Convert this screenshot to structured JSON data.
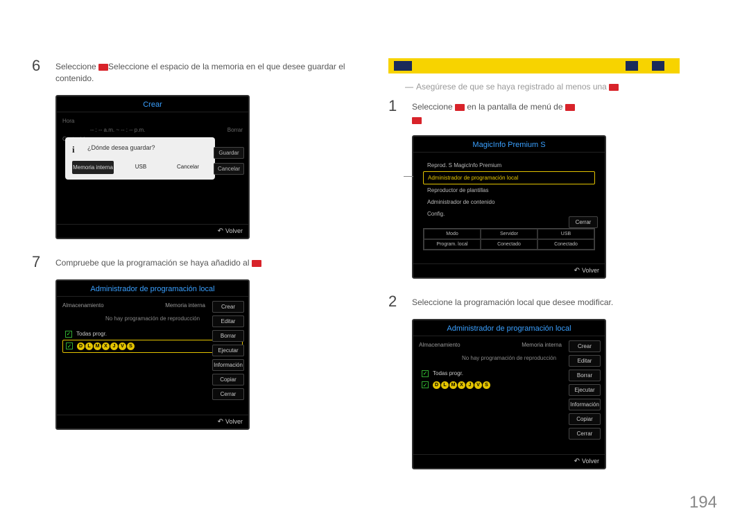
{
  "page_number": "194",
  "left": {
    "step6": {
      "num": "6",
      "text_a": "Seleccione ",
      "text_b": "Seleccione el espacio de la memoria en el que desee guardar el contenido."
    },
    "crear": {
      "title": "Crear",
      "hora": "Hora",
      "time": "-- : -- a.m. ~ -- : -- p.m.",
      "borrar": "Borrar",
      "content": "Contenido",
      "dialog": {
        "question": "¿Dónde desea guardar?",
        "mem": "Memoria interna",
        "usb": "USB",
        "cancel": "Cancelar"
      },
      "guardar": "Guardar",
      "cancelar": "Cancelar",
      "volver": "Volver"
    },
    "step7": {
      "num": "7",
      "text": "Compruebe que la programación se haya añadido al "
    },
    "admin": {
      "title": "Administrador de programación local",
      "storage": "Almacenamiento",
      "mem": "Memoria interna",
      "empty": "No hay programación de reproducción",
      "all": "Todas progr.",
      "days": [
        "D",
        "L",
        "M",
        "X",
        "J",
        "V",
        "S"
      ],
      "buttons": [
        "Crear",
        "Editar",
        "Borrar",
        "Ejecutar",
        "Información",
        "Copiar",
        "Cerrar"
      ],
      "volver": "Volver"
    }
  },
  "right": {
    "note": "Asegúrese de que se haya registrado al menos una ",
    "step1": {
      "num": "1",
      "text_a": "Seleccione ",
      "text_b": " en la pantalla de menú de "
    },
    "magic": {
      "title": "MagicInfo Premium S",
      "items": [
        "Reprod. S MagicInfo Premium",
        "Administrador de programación local",
        "Reproductor de plantillas",
        "Administrador de contenido",
        "Config."
      ],
      "close": "Cerrar",
      "table_h": [
        "Modo",
        "Servidor",
        "USB"
      ],
      "table_v": [
        "Program. local",
        "Conectado",
        "Conectado"
      ],
      "volver": "Volver"
    },
    "step2": {
      "num": "2",
      "text": "Seleccione la programación local que desee modificar."
    },
    "admin": {
      "title": "Administrador de programación local",
      "storage": "Almacenamiento",
      "mem": "Memoria interna",
      "empty": "No hay programación de reproducción",
      "all": "Todas progr.",
      "days": [
        "D",
        "L",
        "M",
        "X",
        "J",
        "V",
        "S"
      ],
      "buttons": [
        "Crear",
        "Editar",
        "Borrar",
        "Ejecutar",
        "Información",
        "Copiar",
        "Cerrar"
      ],
      "volver": "Volver"
    }
  }
}
